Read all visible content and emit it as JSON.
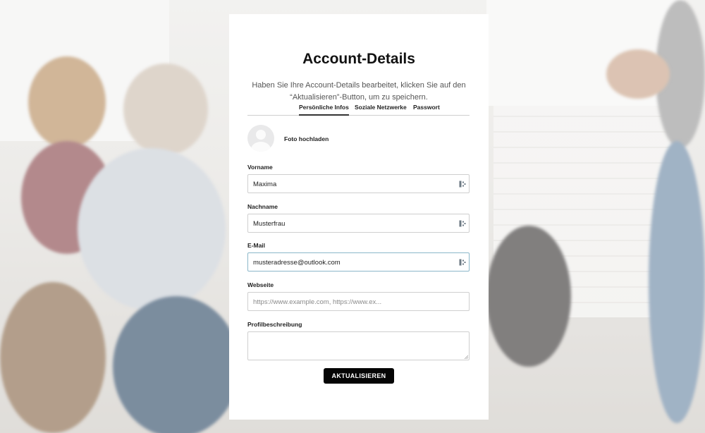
{
  "header": {
    "title": "Account-Details",
    "subtitle_line1": "Haben Sie Ihre Account-Details bearbeitet, klicken Sie auf den",
    "subtitle_line2": "“Aktualisieren”-Button, um zu speichern."
  },
  "tabs": [
    {
      "label": "Persönliche Infos",
      "active": true
    },
    {
      "label": "Soziale Netzwerke",
      "active": false
    },
    {
      "label": "Passwort",
      "active": false
    }
  ],
  "avatar": {
    "upload_label": "Foto hochladen",
    "icon": "user-placeholder-icon"
  },
  "form": {
    "first_name": {
      "label": "Vorname",
      "value": "Maxima",
      "icon": "password-manager-icon"
    },
    "last_name": {
      "label": "Nachname",
      "value": "Musterfrau",
      "icon": "password-manager-icon"
    },
    "email": {
      "label": "E-Mail",
      "value": "musteradresse@outlook.com",
      "icon": "password-manager-icon"
    },
    "website": {
      "label": "Webseite",
      "placeholder": "https://www.example.com, https://www.ex..."
    },
    "bio": {
      "label": "Profilbeschreibung",
      "value": ""
    }
  },
  "submit_label": "AKTUALISIEREN",
  "colors": {
    "button_bg": "#050505",
    "focus_border": "#8bb7c9",
    "card_bg": "#ffffff"
  }
}
